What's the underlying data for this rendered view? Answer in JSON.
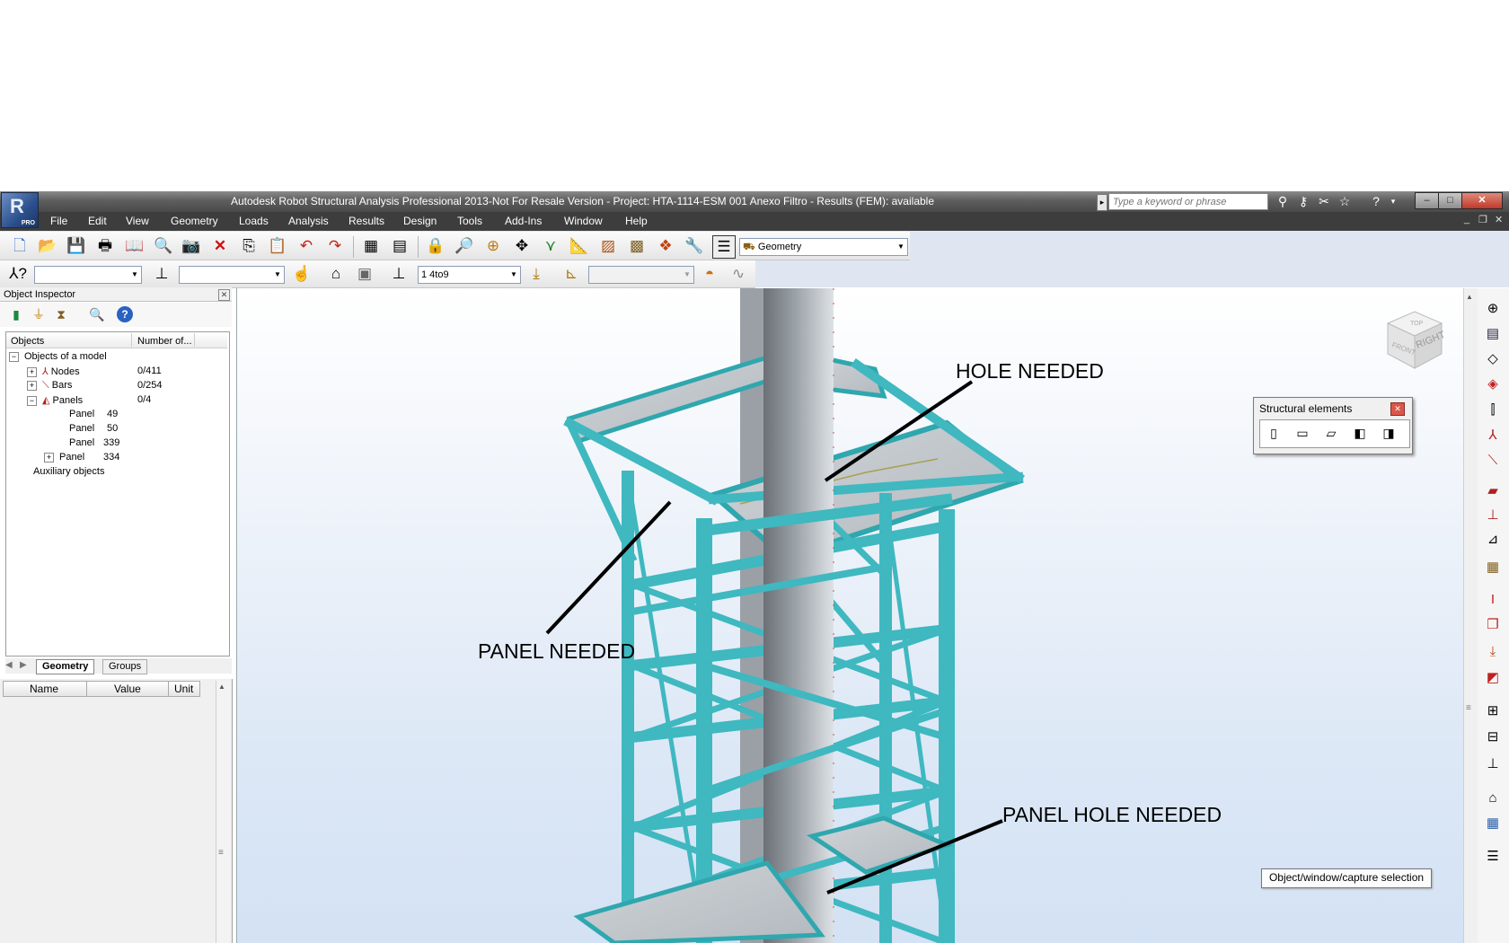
{
  "window": {
    "title": "Autodesk Robot Structural Analysis Professional 2013-Not For Resale Version - Project: HTA-1114-ESM 001 Anexo Filtro - Results (FEM): available",
    "search_placeholder": "Type a keyword or phrase",
    "logo_badge": "PRO"
  },
  "menu": [
    "File",
    "Edit",
    "View",
    "Geometry",
    "Loads",
    "Analysis",
    "Results",
    "Design",
    "Tools",
    "Add-Ins",
    "Window",
    "Help"
  ],
  "toolbar": {
    "layout_combo": "Geometry",
    "case_combo": "1 4to9"
  },
  "inspector": {
    "title": "Object Inspector",
    "columns": [
      "Objects",
      "Number of..."
    ],
    "tree": [
      {
        "label": "Objects of a model",
        "count": ""
      },
      {
        "label": "Nodes",
        "count": "0/411"
      },
      {
        "label": "Bars",
        "count": "0/254"
      },
      {
        "label": "Panels",
        "count": "0/4"
      },
      {
        "label": "Panel",
        "count": "49"
      },
      {
        "label": "Panel",
        "count": "50"
      },
      {
        "label": "Panel",
        "count": "339"
      },
      {
        "label": "Panel",
        "count": "334"
      },
      {
        "label": "Auxiliary objects",
        "count": ""
      }
    ],
    "tabs": [
      "Geometry",
      "Groups"
    ],
    "prop_columns": [
      "Name",
      "Value",
      "Unit"
    ]
  },
  "structural_elements": {
    "title": "Structural elements"
  },
  "nav_cube": {
    "top": "TOP",
    "front": "FRONT",
    "right": "RIGHT"
  },
  "tooltip": "Object/window/capture selection",
  "annotations": {
    "hole": "HOLE NEEDED",
    "panel": "PANEL NEEDED",
    "panel_hole": "PANEL HOLE NEEDED"
  },
  "colors": {
    "steel": "#3fb8c0",
    "panel": "#c8ccd0",
    "column": "#8e959b",
    "titlebar": "#5a5a5a",
    "menubar": "#3d3d3d"
  }
}
